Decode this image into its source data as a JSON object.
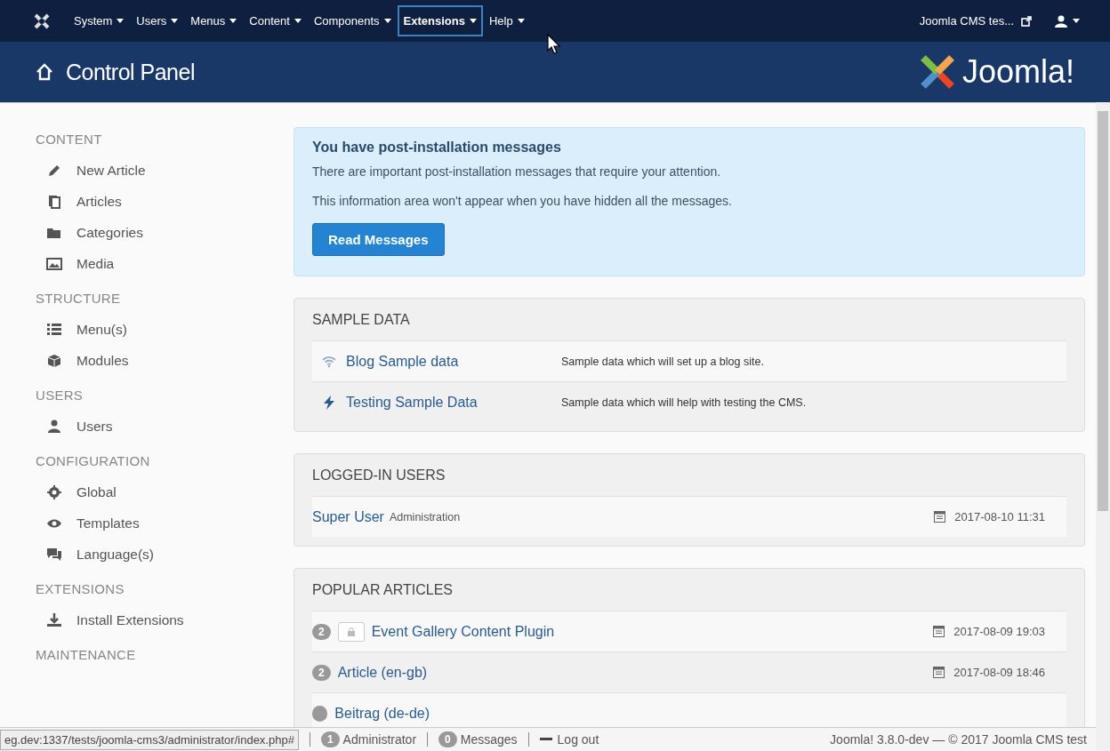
{
  "navbar": {
    "menus": [
      {
        "label": "System",
        "selected": false
      },
      {
        "label": "Users",
        "selected": false
      },
      {
        "label": "Menus",
        "selected": false
      },
      {
        "label": "Content",
        "selected": false
      },
      {
        "label": "Components",
        "selected": false
      },
      {
        "label": "Extensions",
        "selected": true
      },
      {
        "label": "Help",
        "selected": false
      }
    ],
    "site_link": "Joomla CMS tes..."
  },
  "header": {
    "title": "Control Panel",
    "logo_text": "Joomla!"
  },
  "sidebar": {
    "sections": [
      {
        "heading": "CONTENT",
        "items": [
          "New Article",
          "Articles",
          "Categories",
          "Media"
        ]
      },
      {
        "heading": "STRUCTURE",
        "items": [
          "Menu(s)",
          "Modules"
        ]
      },
      {
        "heading": "USERS",
        "items": [
          "Users"
        ]
      },
      {
        "heading": "CONFIGURATION",
        "items": [
          "Global",
          "Templates",
          "Language(s)"
        ]
      },
      {
        "heading": "EXTENSIONS",
        "items": [
          "Install Extensions"
        ]
      },
      {
        "heading": "MAINTENANCE"
      }
    ]
  },
  "alert": {
    "title": "You have post-installation messages",
    "lines": [
      "There are important post-installation messages that require your attention.",
      "This information area won't appear when you have hidden all the messages."
    ],
    "button": "Read Messages"
  },
  "sample_data": {
    "heading": "SAMPLE DATA",
    "rows": [
      {
        "name": "Blog Sample data",
        "description": "Sample data which will set up a blog site."
      },
      {
        "name": "Testing Sample Data",
        "description": "Sample data which will help with testing the CMS."
      }
    ]
  },
  "logged_in_users": {
    "heading": "LOGGED-IN USERS",
    "rows": [
      {
        "name": "Super User",
        "client": "Administration",
        "time": "2017-08-10 11:31"
      }
    ]
  },
  "popular_articles": {
    "heading": "POPULAR ARTICLES",
    "rows": [
      {
        "hits": "2",
        "locked": true,
        "title": "Event Gallery Content Plugin",
        "time": "2017-08-09 19:03"
      },
      {
        "hits": "2",
        "locked": false,
        "title": "Article (en-gb)",
        "time": "2017-08-09 18:46"
      },
      {
        "locked": false,
        "title": "Beitrag (de-de)"
      }
    ]
  },
  "status_bar": {
    "url": "eg.dev:1337/tests/joomla-cms3/administrator/index.php#",
    "admin_count": "1",
    "admin_label": "Administrator",
    "messages_count": "0",
    "messages_label": "Messages",
    "logout": "Log out",
    "version": "Joomla! 3.8.0-dev — © 2017 Joomla CMS test"
  }
}
